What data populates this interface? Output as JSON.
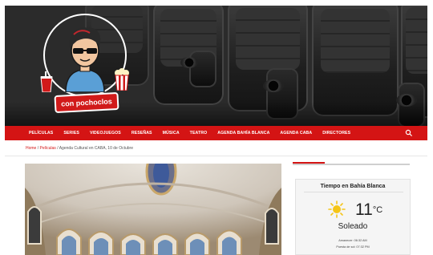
{
  "logo": {
    "tag_text": "con pochoclos"
  },
  "nav": {
    "items": [
      "PELÍCULAS",
      "SERIES",
      "VIDEOJUEGOS",
      "RESEÑAS",
      "MÚSICA",
      "TEATRO",
      "AGENDA BAHÍA BLANCA",
      "AGENDA CABA",
      "DIRECTORES"
    ],
    "search_icon": "search-icon"
  },
  "breadcrumb": {
    "home": "Home",
    "sep1": " / ",
    "section": "Películas",
    "sep2": " / ",
    "current": "Agenda Cultural en CABA, 10 de Octubre"
  },
  "weather": {
    "title": "Tiempo en Bahía Blanca",
    "temp": "11",
    "unit": "°C",
    "condition": "Soleado",
    "sunrise": "Amanecer: 06:32 AM",
    "sunset": "Puesta de sol: 07:32 PM",
    "icon": "sun-icon"
  },
  "colors": {
    "accent": "#d41414",
    "banner": "#2b2b2b"
  }
}
